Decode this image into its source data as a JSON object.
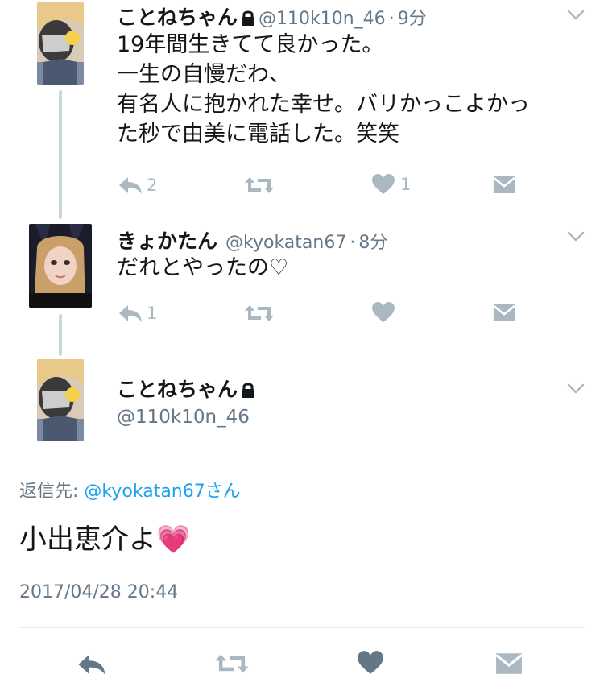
{
  "tweets": [
    {
      "name": "ことねちゃん",
      "handle": "@110k10n_46",
      "sep": "·",
      "time": "9分",
      "locked": true,
      "lines": [
        "19年間生きてて良かった。",
        "一生の自慢だわ、",
        "有名人に抱かれた幸せ。バリかっこよかっ",
        "た秒で由美に電話した。笑笑"
      ],
      "reply_count": "2",
      "like_count": "1"
    },
    {
      "name": "きょかたん",
      "handle": "@kyokatan67",
      "sep": "·",
      "time": "8分",
      "locked": false,
      "lines": [
        "だれとやったの♡"
      ],
      "reply_count": "1",
      "like_count": ""
    }
  ],
  "focused": {
    "name": "ことねちゃん",
    "handle": "@110k10n_46",
    "reply_to_label": "返信先:",
    "reply_to_user": "@kyokatan67さん",
    "text": "小出恵介よ",
    "emoji": "💗",
    "timestamp": "2017/04/28 20:44"
  },
  "colors": {
    "text": "#14171a",
    "muted": "#657786",
    "icon": "#aab8c2",
    "link": "#1da1f2",
    "thread_line": "#ccd6dd"
  },
  "icons": [
    "reply-icon",
    "retweet-icon",
    "like-icon",
    "direct-message-icon",
    "chevron-down-icon",
    "lock-icon"
  ]
}
